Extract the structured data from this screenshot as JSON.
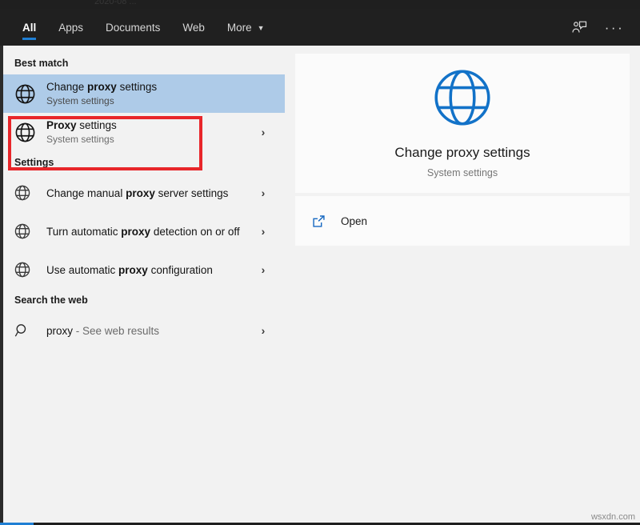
{
  "window": {
    "ghost_top_text": "2020-08 ...",
    "watermark": "wsxdn.com"
  },
  "header": {
    "tabs": [
      {
        "label": "All",
        "active": true
      },
      {
        "label": "Apps",
        "active": false
      },
      {
        "label": "Documents",
        "active": false
      },
      {
        "label": "Web",
        "active": false
      },
      {
        "label": "More",
        "active": false,
        "caret": "▼"
      }
    ],
    "feedback_icon": "feedback-person-icon",
    "overflow_label": "···",
    "accent_color": "#1f7fd4",
    "background_color": "#202020"
  },
  "results": {
    "best_match": {
      "group_label": "Best match",
      "item": {
        "icon": "globe-icon",
        "title_prefix": "Change ",
        "title_bold": "proxy",
        "title_suffix": " settings",
        "subtitle": "System settings",
        "selected": true,
        "highlight_color": "#aecbe8",
        "annotation_color": "#e8262a"
      }
    },
    "other_match": {
      "icon": "globe-icon",
      "title_prefix": "",
      "title_bold": "Proxy",
      "title_suffix": " settings",
      "subtitle": "System settings",
      "chevron": "›"
    },
    "settings": {
      "group_label": "Settings",
      "items": [
        {
          "icon": "globe-outline-icon",
          "title_prefix": "Change manual ",
          "title_bold": "proxy",
          "title_suffix": " server settings",
          "chevron": "›"
        },
        {
          "icon": "globe-outline-icon",
          "title_prefix": "Turn automatic ",
          "title_bold": "proxy",
          "title_suffix": " detection on or off",
          "chevron": "›"
        },
        {
          "icon": "globe-outline-icon",
          "title_prefix": "Use automatic ",
          "title_bold": "proxy",
          "title_suffix": " configuration",
          "chevron": "›"
        }
      ]
    },
    "search_the_web": {
      "group_label": "Search the web",
      "item": {
        "icon": "search-icon",
        "query": "proxy",
        "suffix": " - See web results",
        "chevron": "›"
      }
    }
  },
  "preview": {
    "icon": "globe-icon-large",
    "icon_color": "#1272c8",
    "title": "Change proxy settings",
    "subtitle": "System settings",
    "actions": [
      {
        "icon": "open-external-icon",
        "label": "Open"
      }
    ]
  }
}
